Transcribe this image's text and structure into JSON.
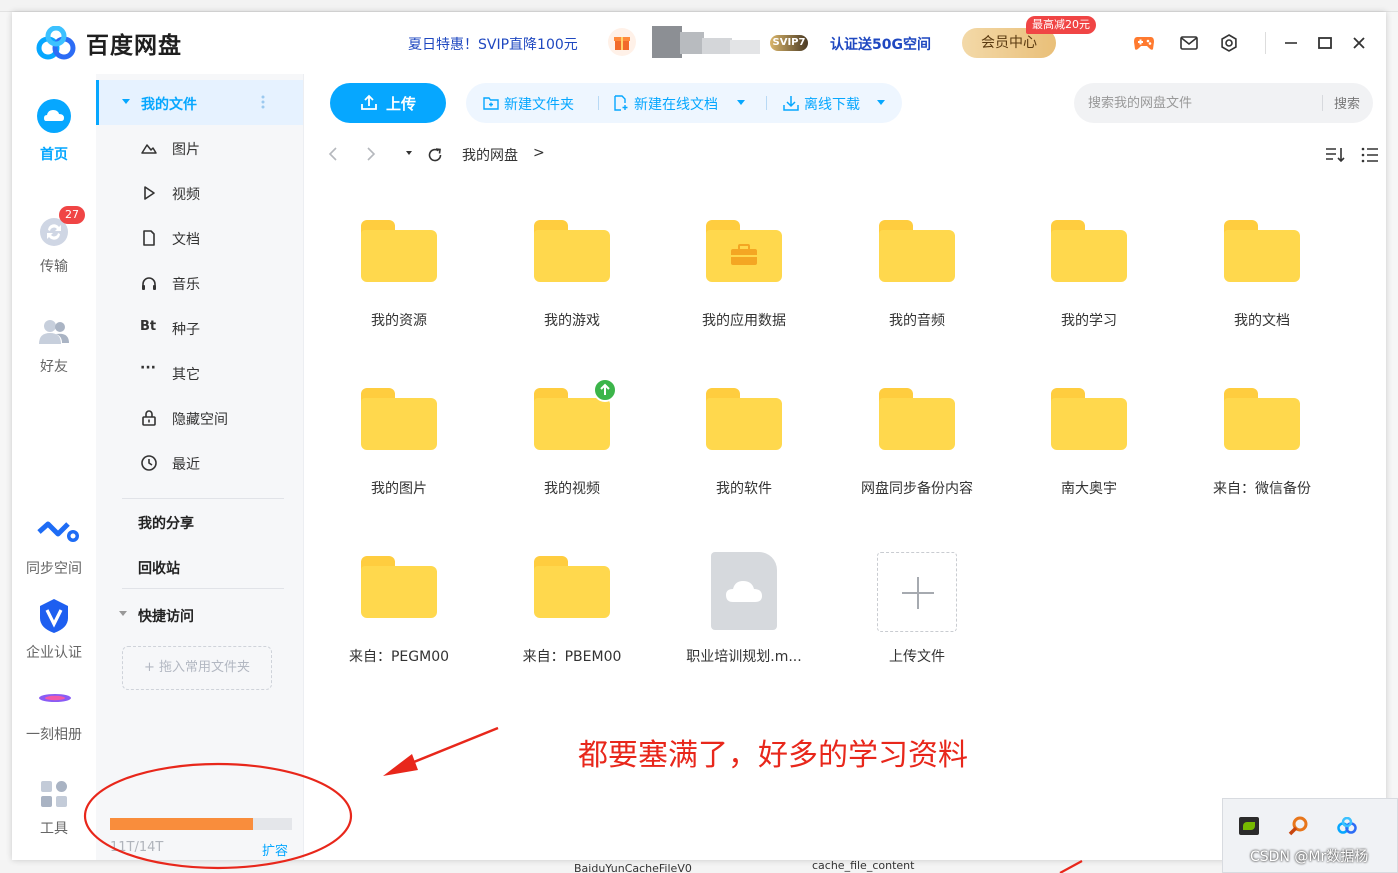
{
  "app": {
    "title": "百度网盘",
    "promo": "夏日特惠！SVIP直降100元",
    "level_badge": "SVIP7",
    "cert_link": "认证送50G空间",
    "member_center": "会员中心",
    "member_tag": "最高减20元"
  },
  "rail": {
    "home": "首页",
    "transfer": "传输",
    "transfer_badge": "27",
    "friends": "好友",
    "sync": "同步空间",
    "enterprise": "企业认证",
    "album": "一刻相册",
    "tools": "工具"
  },
  "sidebar": {
    "my_files": "我的文件",
    "items": [
      "图片",
      "视频",
      "文档",
      "音乐",
      "种子",
      "其它",
      "隐藏空间",
      "最近"
    ],
    "bt_label": "Bt",
    "more_label": "···",
    "my_share": "我的分享",
    "recycle": "回收站",
    "quick_access": "快捷访问",
    "drop_hint": "+ 拖入常用文件夹",
    "storage_text": "11T/14T",
    "storage_used_fraction": 0.786,
    "expand": "扩容"
  },
  "toolbar": {
    "upload": "上传",
    "new_folder": "新建文件夹",
    "new_doc": "新建在线文档",
    "offline_download": "离线下载",
    "search_placeholder": "搜索我的网盘文件",
    "search_button": "搜索"
  },
  "breadcrumb": {
    "path": "我的网盘",
    "sep": ">"
  },
  "files": [
    {
      "name": "我的资源",
      "kind": "folder"
    },
    {
      "name": "我的游戏",
      "kind": "folder"
    },
    {
      "name": "我的应用数据",
      "kind": "folder-app"
    },
    {
      "name": "我的音频",
      "kind": "folder"
    },
    {
      "name": "我的学习",
      "kind": "folder"
    },
    {
      "name": "我的文档",
      "kind": "folder"
    },
    {
      "name": "我的图片",
      "kind": "folder"
    },
    {
      "name": "我的视频",
      "kind": "folder-upload"
    },
    {
      "name": "我的软件",
      "kind": "folder"
    },
    {
      "name": "网盘同步备份内容",
      "kind": "folder"
    },
    {
      "name": "南大奥宇",
      "kind": "folder"
    },
    {
      "name": "来自：微信备份",
      "kind": "folder"
    },
    {
      "name": "来自：PEGM00",
      "kind": "folder"
    },
    {
      "name": "来自：PBEM00",
      "kind": "folder"
    },
    {
      "name": "职业培训规划.m...",
      "kind": "doc"
    },
    {
      "name": "上传文件",
      "kind": "add"
    }
  ],
  "annotation": {
    "text": "都要塞满了，好多的学习资料"
  },
  "watermark": "CSDN @Mr数据杨",
  "background": {
    "frag_1": "BaiduYunCacheFileV0",
    "frag_2": "cache_file_content"
  },
  "colors": {
    "accent": "#06a7ff",
    "folder": "#ffd84d",
    "storage_fill": "#f98d3c",
    "annotation_red": "#e8271b"
  }
}
